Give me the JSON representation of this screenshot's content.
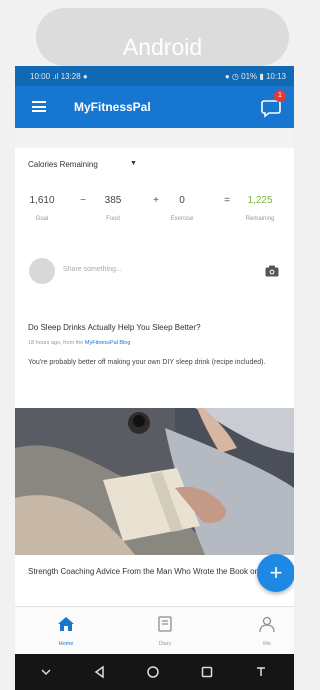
{
  "platform_label": "Android",
  "status_bar": {
    "left": "10:00 .ıl 13:28 ●",
    "right": "● ◷ 01% ▮ 10:13"
  },
  "app": {
    "title": "MyFitnessPal",
    "badge": "1"
  },
  "calories": {
    "title": "Calories Remaining",
    "goal": "1,610",
    "goal_label": "Goal",
    "food": "385",
    "food_label": "Food",
    "exercise": "0",
    "exercise_label": "Exercise",
    "remaining": "1,225",
    "remaining_label": "Remaining",
    "op_minus": "−",
    "op_plus": "+",
    "op_equals": "="
  },
  "share": {
    "placeholder": "Share something..."
  },
  "article": {
    "title": "Do Sleep Drinks Actually Help You Sleep Better?",
    "meta_prefix": "18 hours ago, from the",
    "meta_link": "MyFitnessPal Blog",
    "body": "You're probably better off making your own DIY sleep drink (recipe included).",
    "next_title": "Strength Coaching Advice From the Man Who Wrote the Book on It"
  },
  "fab_label": "+",
  "nav": [
    {
      "label": "Home",
      "icon": "home-icon"
    },
    {
      "label": "Diary",
      "icon": "diary-icon"
    },
    {
      "label": "Me",
      "icon": "person-icon"
    }
  ],
  "colors": {
    "app_bar": "#1676d0",
    "status_bar": "#1269b3",
    "fab": "#1e88e5",
    "remaining": "#7cb342"
  }
}
